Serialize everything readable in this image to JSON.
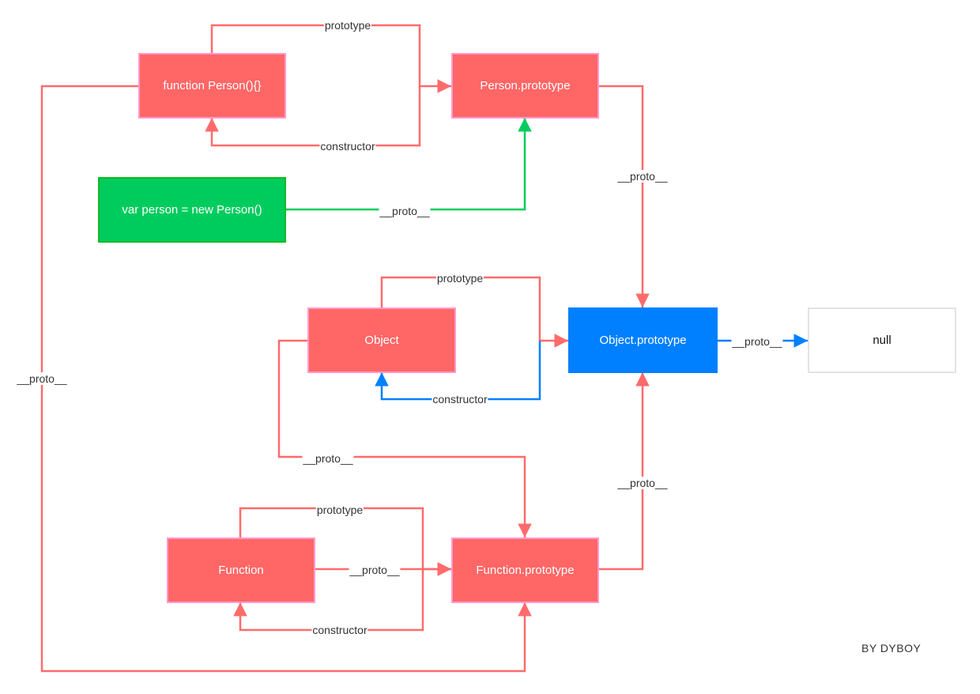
{
  "nodes": {
    "function_person": "function Person(){}",
    "person_prototype": "Person.prototype",
    "person_instance": "var person = new Person()",
    "object": "Object",
    "object_prototype": "Object.prototype",
    "null": "null",
    "function": "Function",
    "function_prototype": "Function.prototype"
  },
  "edges": {
    "person_prototype": "prototype",
    "person_constructor": "constructor",
    "instance_proto": "__proto__",
    "person_prototype_proto": "__proto__",
    "object_prototype": "prototype",
    "object_constructor": "constructor",
    "object_prototype_proto": "__proto__",
    "object_proto": "__proto__",
    "function_prototype_proto": "__proto__",
    "function_prototype": "prototype",
    "function_constructor": "constructor",
    "function_proto": "__proto__",
    "person_proto": "__proto__"
  },
  "signature": "BY DYBOY",
  "colors": {
    "red": "#ff6666",
    "green": "#00cc5e",
    "blue": "#0080ff",
    "box_border": "#ff99cc"
  }
}
